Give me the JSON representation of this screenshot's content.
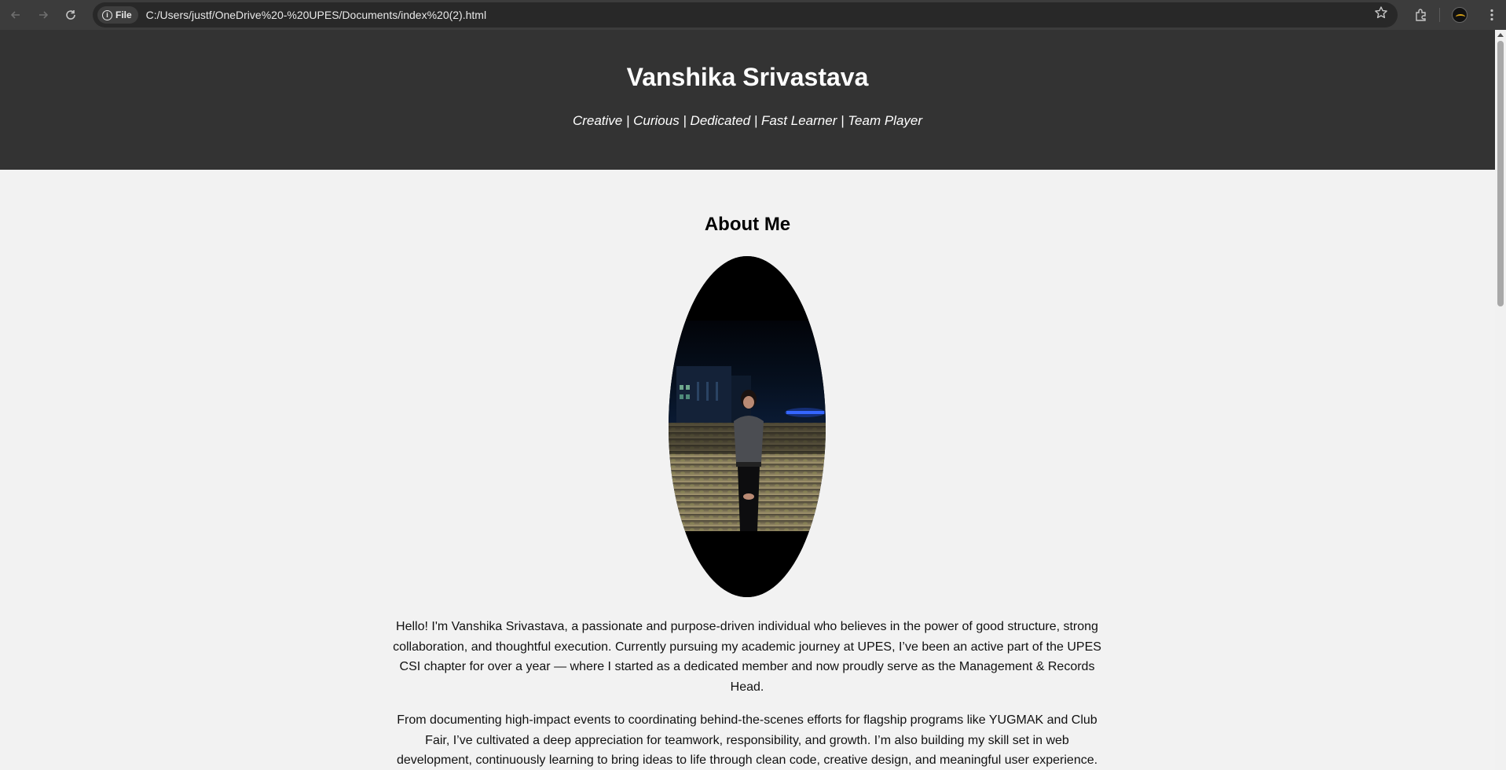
{
  "browser": {
    "chip_label": "File",
    "url": "C:/Users/justf/OneDrive%20-%20UPES/Documents/index%20(2).html"
  },
  "icons": [
    "back-icon",
    "forward-icon",
    "reload-icon",
    "info-icon",
    "star-icon",
    "extensions-icon",
    "profile-avatar",
    "more-menu-icon"
  ],
  "hero": {
    "name": "Vanshika Srivastava",
    "tagline": "Creative | Curious | Dedicated | Fast Learner | Team Player",
    "background": "#333333"
  },
  "about": {
    "title": "About Me",
    "paragraphs": [
      "Hello! I'm Vanshika Srivastava, a passionate and purpose-driven individual who believes in the power of good structure, strong collaboration, and thoughtful execution. Currently pursuing my academic journey at UPES, I’ve been an active part of the UPES CSI chapter for over a year — where I started as a dedicated member and now proudly serve as the Management & Records Head.",
      "From documenting high-impact events to coordinating behind-the-scenes efforts for flagship programs like YUGMAK and Club Fair, I’ve cultivated a deep appreciation for teamwork, responsibility, and growth. I’m also building my skill set in web development, continuously learning to bring ideas to life through clean code, creative design, and meaningful user experience."
    ]
  }
}
